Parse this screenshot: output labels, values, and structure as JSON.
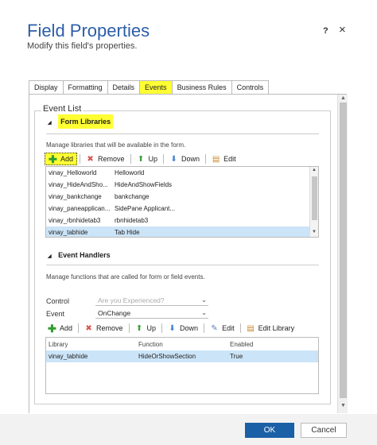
{
  "dialog": {
    "title": "Field Properties",
    "subtitle": "Modify this field's properties.",
    "help": "?",
    "close": "×"
  },
  "tabs": [
    {
      "label": "Display",
      "active": false
    },
    {
      "label": "Formatting",
      "active": false
    },
    {
      "label": "Details",
      "active": false
    },
    {
      "label": "Events",
      "active": true
    },
    {
      "label": "Business Rules",
      "active": false
    },
    {
      "label": "Controls",
      "active": false
    }
  ],
  "event_list": {
    "legend": "Event List",
    "form_libraries": {
      "heading": "Form Libraries",
      "description": "Manage libraries that will be available in the form.",
      "toolbar": {
        "add": "Add",
        "remove": "Remove",
        "up": "Up",
        "down": "Down",
        "edit": "Edit"
      },
      "rows": [
        {
          "name": "vinay_Helloworld",
          "display": "Helloworld",
          "selected": false
        },
        {
          "name": "vinay_HideAndSho...",
          "display": "HideAndShowFields",
          "selected": false
        },
        {
          "name": "vinay_bankchange",
          "display": "bankchange",
          "selected": false
        },
        {
          "name": "vinay_paneapplican...",
          "display": "SidePane Applicant...",
          "selected": false
        },
        {
          "name": "vinay_rbnhidetab3",
          "display": "rbnhidetab3",
          "selected": false
        },
        {
          "name": "vinay_tabhide",
          "display": "Tab Hide",
          "selected": true
        }
      ]
    },
    "event_handlers": {
      "heading": "Event Handlers",
      "description": "Manage functions that are called for form or field events.",
      "control_label": "Control",
      "control_value": "Are you Experienced?",
      "event_label": "Event",
      "event_value": "OnChange",
      "toolbar": {
        "add": "Add",
        "remove": "Remove",
        "up": "Up",
        "down": "Down",
        "edit": "Edit",
        "edit_library": "Edit Library"
      },
      "columns": [
        "Library",
        "Function",
        "Enabled"
      ],
      "rows": [
        {
          "library": "vinay_tabhide",
          "function": "HideOrShowSection",
          "enabled": "True"
        }
      ]
    }
  },
  "footer": {
    "ok": "OK",
    "cancel": "Cancel"
  },
  "colors": {
    "accent": "#1b5fa6",
    "title": "#2c5ea8",
    "highlight": "#ffff33",
    "selection": "#cce4f7"
  }
}
